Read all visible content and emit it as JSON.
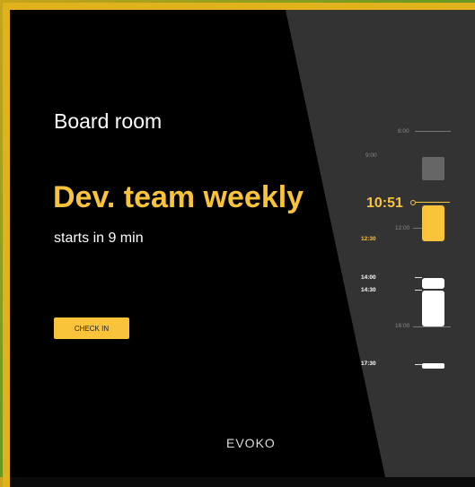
{
  "room": {
    "name": "Board room"
  },
  "meeting": {
    "title": "Dev. team weekly",
    "starts_in": "starts in 9 min",
    "check_in_label": "CHECK IN"
  },
  "brand": {
    "logo_text": "EVOKO"
  },
  "timeline": {
    "current_time": "10:51",
    "hour_labels": [
      "8:00",
      "9:00",
      "12:00",
      "16:00"
    ],
    "event_times": [
      "12:30",
      "14:00",
      "14:30",
      "17:30"
    ]
  },
  "colors": {
    "accent": "#f9c33a",
    "background": "#000000",
    "timeline_panel": "#333333",
    "busy_block": "#666666",
    "free_block": "#ffffff"
  }
}
